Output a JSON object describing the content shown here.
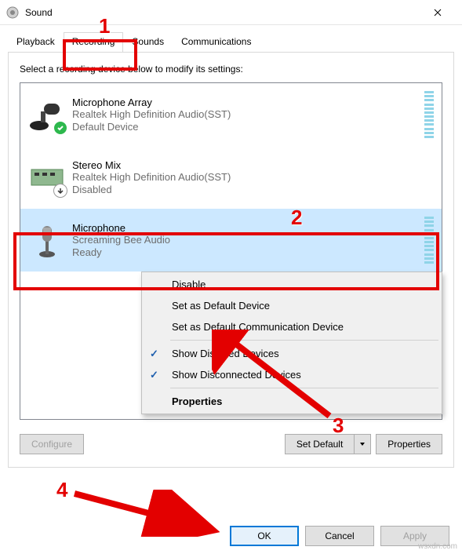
{
  "window": {
    "title": "Sound"
  },
  "tabs": [
    "Playback",
    "Recording",
    "Sounds",
    "Communications"
  ],
  "active_tab": "Recording",
  "instruction": "Select a recording device below to modify its settings:",
  "devices": [
    {
      "name": "Microphone Array",
      "desc": "Realtek High Definition Audio(SST)",
      "status": "Default Device"
    },
    {
      "name": "Stereo Mix",
      "desc": "Realtek High Definition Audio(SST)",
      "status": "Disabled"
    },
    {
      "name": "Microphone",
      "desc": "Screaming Bee Audio",
      "status": "Ready"
    }
  ],
  "context_menu": {
    "disable": "Disable",
    "set_default": "Set as Default Device",
    "set_comm": "Set as Default Communication Device",
    "show_disabled": "Show Disabled Devices",
    "show_disconnected": "Show Disconnected Devices",
    "properties": "Properties"
  },
  "buttons": {
    "configure": "Configure",
    "set_default": "Set Default",
    "properties": "Properties",
    "ok": "OK",
    "cancel": "Cancel",
    "apply": "Apply"
  },
  "annotations": {
    "n1": "1",
    "n2": "2",
    "n3": "3",
    "n4": "4"
  },
  "watermark": "wsxdn.com"
}
